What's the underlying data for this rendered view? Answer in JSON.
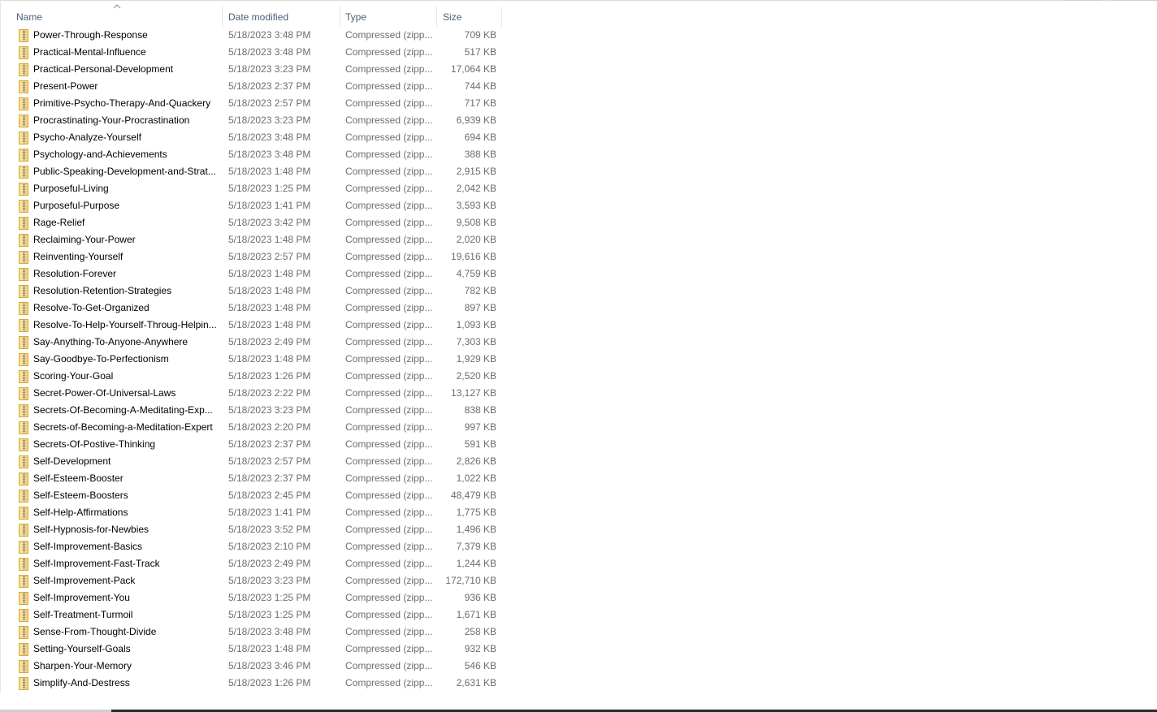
{
  "columns": {
    "name": "Name",
    "date": "Date modified",
    "type": "Type",
    "size": "Size",
    "sort_indicator": "sort-ascending-icon"
  },
  "files": [
    {
      "name": "Power-Through-Response",
      "date": "5/18/2023 3:48 PM",
      "type": "Compressed (zipp...",
      "size": "709 KB"
    },
    {
      "name": "Practical-Mental-Influence",
      "date": "5/18/2023 3:48 PM",
      "type": "Compressed (zipp...",
      "size": "517 KB"
    },
    {
      "name": "Practical-Personal-Development",
      "date": "5/18/2023 3:23 PM",
      "type": "Compressed (zipp...",
      "size": "17,064 KB"
    },
    {
      "name": "Present-Power",
      "date": "5/18/2023 2:37 PM",
      "type": "Compressed (zipp...",
      "size": "744 KB"
    },
    {
      "name": "Primitive-Psycho-Therapy-And-Quackery",
      "date": "5/18/2023 2:57 PM",
      "type": "Compressed (zipp...",
      "size": "717 KB"
    },
    {
      "name": "Procrastinating-Your-Procrastination",
      "date": "5/18/2023 3:23 PM",
      "type": "Compressed (zipp...",
      "size": "6,939 KB"
    },
    {
      "name": "Psycho-Analyze-Yourself",
      "date": "5/18/2023 3:48 PM",
      "type": "Compressed (zipp...",
      "size": "694 KB"
    },
    {
      "name": "Psychology-and-Achievements",
      "date": "5/18/2023 3:48 PM",
      "type": "Compressed (zipp...",
      "size": "388 KB"
    },
    {
      "name": "Public-Speaking-Development-and-Strat...",
      "date": "5/18/2023 1:48 PM",
      "type": "Compressed (zipp...",
      "size": "2,915 KB"
    },
    {
      "name": "Purposeful-Living",
      "date": "5/18/2023 1:25 PM",
      "type": "Compressed (zipp...",
      "size": "2,042 KB"
    },
    {
      "name": "Purposeful-Purpose",
      "date": "5/18/2023 1:41 PM",
      "type": "Compressed (zipp...",
      "size": "3,593 KB"
    },
    {
      "name": "Rage-Relief",
      "date": "5/18/2023 3:42 PM",
      "type": "Compressed (zipp...",
      "size": "9,508 KB"
    },
    {
      "name": "Reclaiming-Your-Power",
      "date": "5/18/2023 1:48 PM",
      "type": "Compressed (zipp...",
      "size": "2,020 KB"
    },
    {
      "name": "Reinventing-Yourself",
      "date": "5/18/2023 2:57 PM",
      "type": "Compressed (zipp...",
      "size": "19,616 KB"
    },
    {
      "name": "Resolution-Forever",
      "date": "5/18/2023 1:48 PM",
      "type": "Compressed (zipp...",
      "size": "4,759 KB"
    },
    {
      "name": "Resolution-Retention-Strategies",
      "date": "5/18/2023 1:48 PM",
      "type": "Compressed (zipp...",
      "size": "782 KB"
    },
    {
      "name": "Resolve-To-Get-Organized",
      "date": "5/18/2023 1:48 PM",
      "type": "Compressed (zipp...",
      "size": "897 KB"
    },
    {
      "name": "Resolve-To-Help-Yourself-Throug-Helpin...",
      "date": "5/18/2023 1:48 PM",
      "type": "Compressed (zipp...",
      "size": "1,093 KB"
    },
    {
      "name": "Say-Anything-To-Anyone-Anywhere",
      "date": "5/18/2023 2:49 PM",
      "type": "Compressed (zipp...",
      "size": "7,303 KB"
    },
    {
      "name": "Say-Goodbye-To-Perfectionism",
      "date": "5/18/2023 1:48 PM",
      "type": "Compressed (zipp...",
      "size": "1,929 KB"
    },
    {
      "name": "Scoring-Your-Goal",
      "date": "5/18/2023 1:26 PM",
      "type": "Compressed (zipp...",
      "size": "2,520 KB"
    },
    {
      "name": "Secret-Power-Of-Universal-Laws",
      "date": "5/18/2023 2:22 PM",
      "type": "Compressed (zipp...",
      "size": "13,127 KB"
    },
    {
      "name": "Secrets-Of-Becoming-A-Meditating-Exp...",
      "date": "5/18/2023 3:23 PM",
      "type": "Compressed (zipp...",
      "size": "838 KB"
    },
    {
      "name": "Secrets-of-Becoming-a-Meditation-Expert",
      "date": "5/18/2023 2:20 PM",
      "type": "Compressed (zipp...",
      "size": "997 KB"
    },
    {
      "name": "Secrets-Of-Postive-Thinking",
      "date": "5/18/2023 2:37 PM",
      "type": "Compressed (zipp...",
      "size": "591 KB"
    },
    {
      "name": "Self-Development",
      "date": "5/18/2023 2:57 PM",
      "type": "Compressed (zipp...",
      "size": "2,826 KB"
    },
    {
      "name": "Self-Esteem-Booster",
      "date": "5/18/2023 2:37 PM",
      "type": "Compressed (zipp...",
      "size": "1,022 KB"
    },
    {
      "name": "Self-Esteem-Boosters",
      "date": "5/18/2023 2:45 PM",
      "type": "Compressed (zipp...",
      "size": "48,479 KB"
    },
    {
      "name": "Self-Help-Affirmations",
      "date": "5/18/2023 1:41 PM",
      "type": "Compressed (zipp...",
      "size": "1,775 KB"
    },
    {
      "name": "Self-Hypnosis-for-Newbies",
      "date": "5/18/2023 3:52 PM",
      "type": "Compressed (zipp...",
      "size": "1,496 KB"
    },
    {
      "name": "Self-Improvement-Basics",
      "date": "5/18/2023 2:10 PM",
      "type": "Compressed (zipp...",
      "size": "7,379 KB"
    },
    {
      "name": "Self-Improvement-Fast-Track",
      "date": "5/18/2023 2:49 PM",
      "type": "Compressed (zipp...",
      "size": "1,244 KB"
    },
    {
      "name": "Self-Improvement-Pack",
      "date": "5/18/2023 3:23 PM",
      "type": "Compressed (zipp...",
      "size": "172,710 KB"
    },
    {
      "name": "Self-Improvement-You",
      "date": "5/18/2023 1:25 PM",
      "type": "Compressed (zipp...",
      "size": "936 KB"
    },
    {
      "name": "Self-Treatment-Turmoil",
      "date": "5/18/2023 1:25 PM",
      "type": "Compressed (zipp...",
      "size": "1,671 KB"
    },
    {
      "name": "Sense-From-Thought-Divide",
      "date": "5/18/2023 3:48 PM",
      "type": "Compressed (zipp...",
      "size": "258 KB"
    },
    {
      "name": "Setting-Yourself-Goals",
      "date": "5/18/2023 1:48 PM",
      "type": "Compressed (zipp...",
      "size": "932 KB"
    },
    {
      "name": "Sharpen-Your-Memory",
      "date": "5/18/2023 3:46 PM",
      "type": "Compressed (zipp...",
      "size": "546 KB"
    },
    {
      "name": "Simplify-And-Destress",
      "date": "5/18/2023 1:26 PM",
      "type": "Compressed (zipp...",
      "size": "2,631 KB"
    }
  ],
  "file_icon": "zip-folder-icon",
  "colors": {
    "header_text": "#4c607a",
    "secondary_text": "#6d6d6d",
    "zip_folder": "#f5c842",
    "taskbar": "#1f2c33"
  }
}
